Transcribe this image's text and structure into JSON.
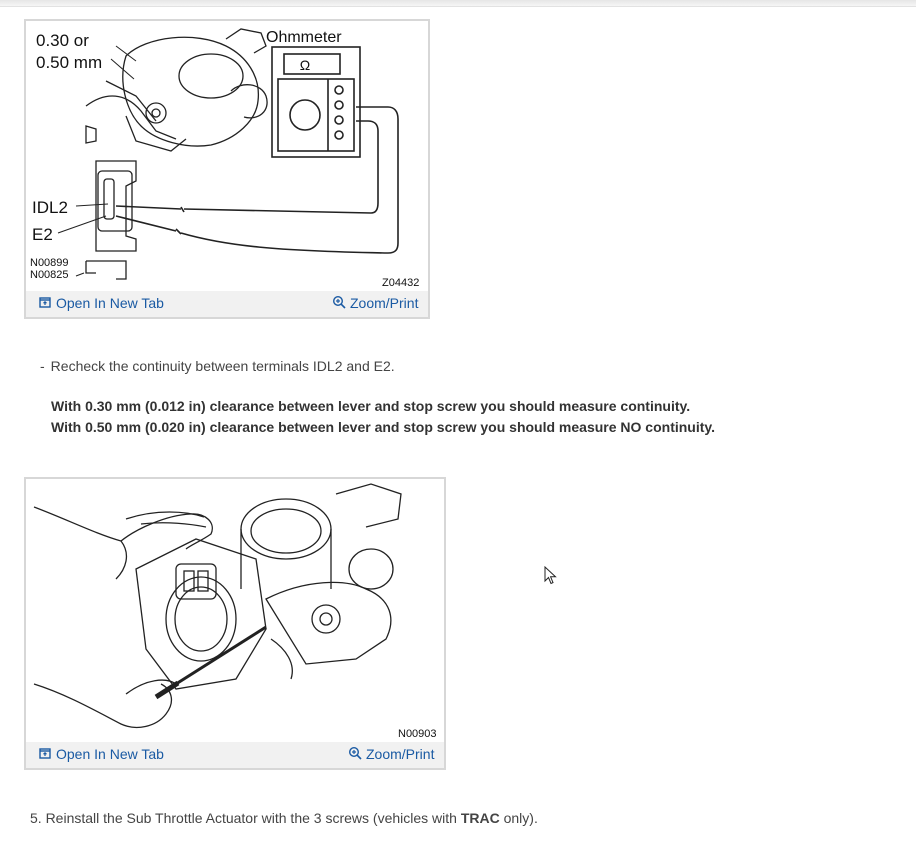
{
  "figure1": {
    "callouts": {
      "clearance_line1": "0.30 or",
      "clearance_line2": "0.50 mm",
      "meter_label": "Ohmmeter",
      "meter_symbol": "Ω",
      "terminal_idl2": "IDL2",
      "terminal_e2": "E2",
      "code_a": "N00899",
      "code_b": "N00825",
      "figure_code": "Z04432"
    },
    "open_label": "Open In New Tab",
    "zoom_label": "Zoom/Print"
  },
  "bullet": {
    "dash": "-",
    "text": "Recheck the continuity between terminals IDL2 and E2."
  },
  "spec": {
    "line1": "With 0.30 mm (0.012 in) clearance between lever and stop screw you should measure continuity.",
    "line2": "With 0.50 mm (0.020 in) clearance between lever and stop screw you should measure NO continuity."
  },
  "figure2": {
    "figure_code": "N00903",
    "open_label": "Open In New Tab",
    "zoom_label": "Zoom/Print"
  },
  "step5": {
    "prefix": "5. Reinstall the Sub Throttle Actuator with the 3 screws (vehicles with ",
    "bold": "TRAC",
    "suffix": " only)."
  },
  "colors": {
    "link": "#1a5aa3",
    "figure_border": "#d7d7d7",
    "figure_bar": "#f1f1f1"
  },
  "icons": {
    "open": "open-new-tab-icon",
    "zoom": "zoom-in-icon",
    "cursor": "mouse-pointer-icon"
  }
}
